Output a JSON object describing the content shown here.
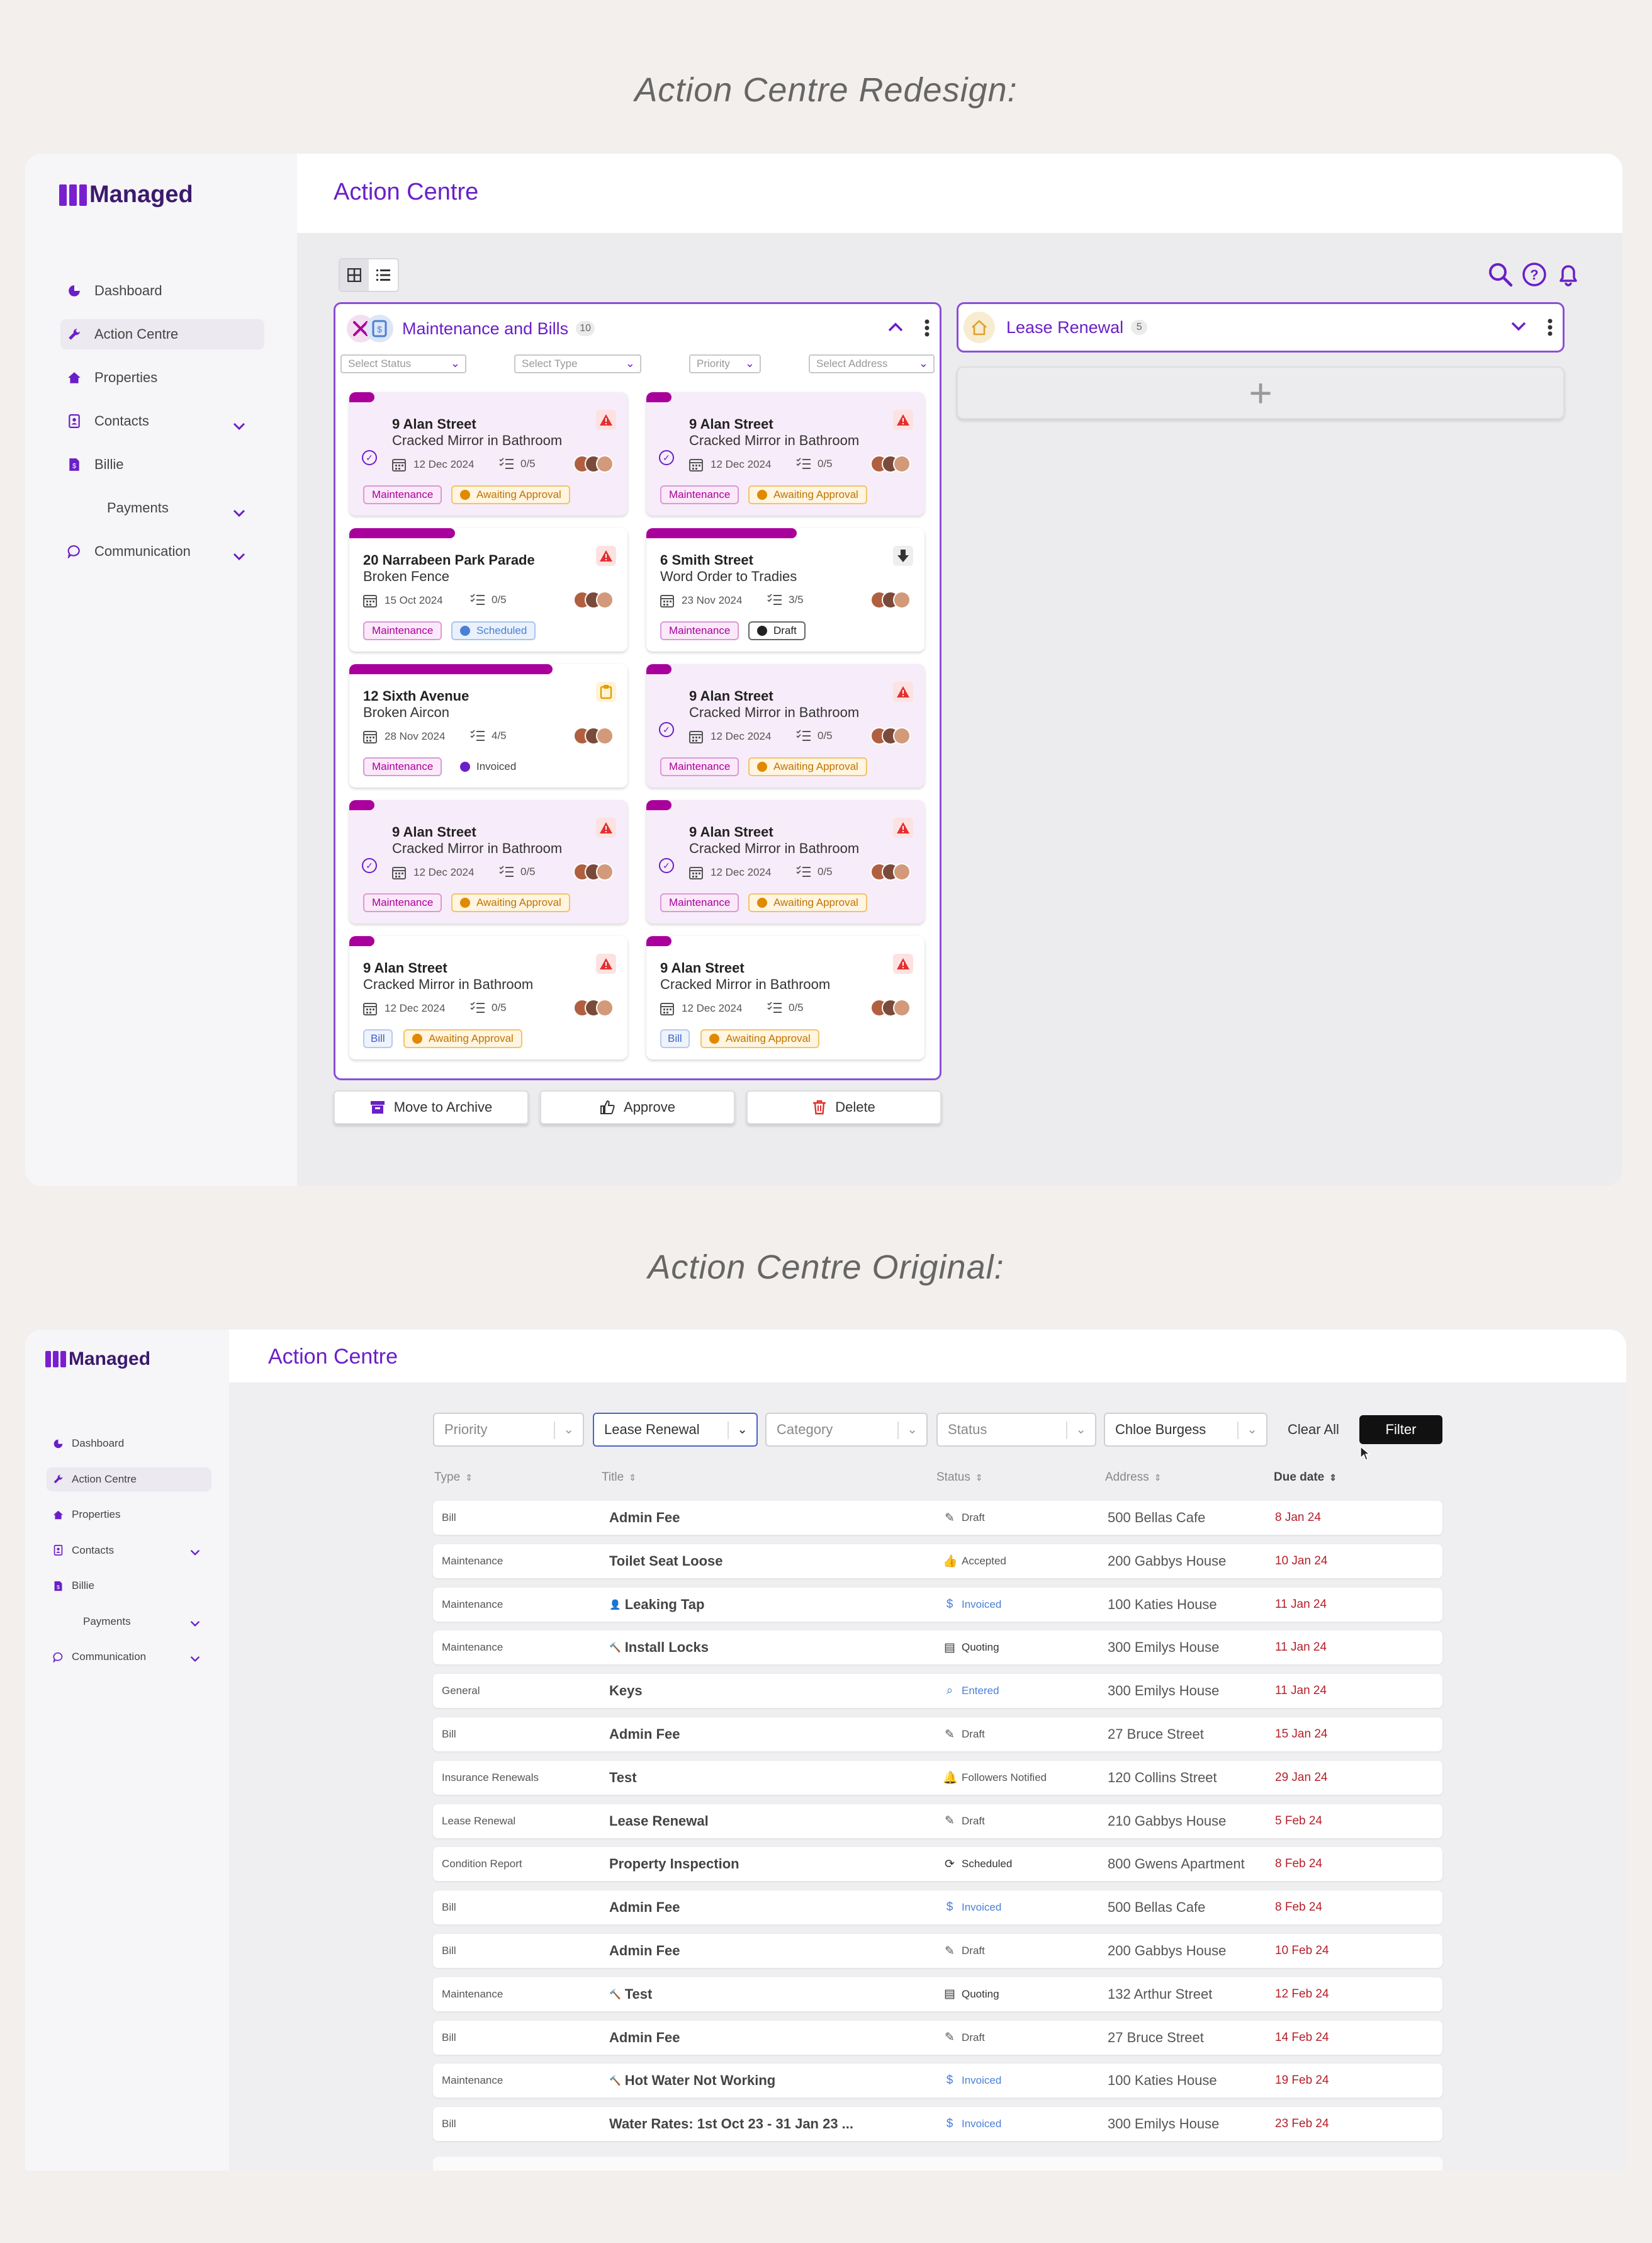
{
  "headings": {
    "redesign": "Action Centre Redesign:",
    "original": "Action Centre Original:"
  },
  "brand": {
    "name": "Managed",
    "accent": "#6a1fc7",
    "magenta": "#a9009c"
  },
  "nav": [
    {
      "label": "Dashboard",
      "icon": "pie-chart-icon",
      "chevron": false,
      "active": false
    },
    {
      "label": "Action Centre",
      "icon": "wrench-icon",
      "chevron": false,
      "active": true
    },
    {
      "label": "Properties",
      "icon": "home-icon",
      "chevron": false,
      "active": false
    },
    {
      "label": "Contacts",
      "icon": "contact-book-icon",
      "chevron": true,
      "active": false
    },
    {
      "label": "Billie",
      "icon": "bill-icon",
      "chevron": false,
      "active": false
    },
    {
      "label": "Payments",
      "icon": "",
      "chevron": true,
      "active": false
    },
    {
      "label": "Communication",
      "icon": "chat-bubble-icon",
      "chevron": true,
      "active": false
    }
  ],
  "redesign": {
    "title": "Action Centre",
    "groups": {
      "maintenance": {
        "title": "Maintenance and Bills",
        "count": "10"
      },
      "lease": {
        "title": "Lease Renewal",
        "count": "5"
      }
    },
    "filters": {
      "status": "Select Status",
      "type": "Select Type",
      "priority": "Priority",
      "address": "Select Address"
    },
    "cards": [
      {
        "address": "9 Alan Street",
        "description": "Cracked Mirror in Bathroom",
        "date": "12 Dec 2024",
        "tasks": "0/5",
        "category": "Maintenance",
        "status": "Awaiting Approval",
        "status_color": "#e08a00",
        "progress": 0.07,
        "bg": "pink",
        "checked": true,
        "flag": "warning"
      },
      {
        "address": "9 Alan Street",
        "description": "Cracked Mirror in Bathroom",
        "date": "12 Dec 2024",
        "tasks": "0/5",
        "category": "Maintenance",
        "status": "Awaiting Approval",
        "status_color": "#e08a00",
        "progress": 0.07,
        "bg": "pink",
        "checked": true,
        "flag": "warning"
      },
      {
        "address": "20 Narrabeen Park Parade",
        "description": "Broken Fence",
        "date": "15 Oct 2024",
        "tasks": "0/5",
        "category": "Maintenance",
        "status": "Scheduled",
        "status_color": "#4a7fd6",
        "progress": 0.38,
        "bg": "white",
        "checked": false,
        "flag": "warning"
      },
      {
        "address": "6 Smith Street",
        "description": "Word Order to Tradies",
        "date": "23 Nov 2024",
        "tasks": "3/5",
        "category": "Maintenance",
        "status": "Draft",
        "status_color": "#222222",
        "progress": 0.54,
        "bg": "white",
        "checked": false,
        "flag": "download"
      },
      {
        "address": "12 Sixth Avenue",
        "description": "Broken Aircon",
        "date": "28 Nov 2024",
        "tasks": "4/5",
        "category": "Maintenance",
        "status": "Invoiced",
        "status_color": "#6a1fc7",
        "progress": 0.73,
        "bg": "white",
        "checked": false,
        "flag": "clipboard"
      },
      {
        "address": "9 Alan Street",
        "description": "Cracked Mirror in Bathroom",
        "date": "12 Dec 2024",
        "tasks": "0/5",
        "category": "Maintenance",
        "status": "Awaiting Approval",
        "status_color": "#e08a00",
        "progress": 0.07,
        "bg": "pink",
        "checked": true,
        "flag": "warning"
      },
      {
        "address": "9 Alan Street",
        "description": "Cracked Mirror in Bathroom",
        "date": "12 Dec 2024",
        "tasks": "0/5",
        "category": "Maintenance",
        "status": "Awaiting Approval",
        "status_color": "#e08a00",
        "progress": 0.07,
        "bg": "pink",
        "checked": true,
        "flag": "warning"
      },
      {
        "address": "9 Alan Street",
        "description": "Cracked Mirror in Bathroom",
        "date": "12 Dec 2024",
        "tasks": "0/5",
        "category": "Maintenance",
        "status": "Awaiting Approval",
        "status_color": "#e08a00",
        "progress": 0.07,
        "bg": "pink",
        "checked": true,
        "flag": "warning"
      },
      {
        "address": "9 Alan Street",
        "description": "Cracked Mirror in Bathroom",
        "date": "12 Dec 2024",
        "tasks": "0/5",
        "category": "Bill",
        "status": "Awaiting Approval",
        "status_color": "#e08a00",
        "progress": 0.07,
        "bg": "white",
        "checked": false,
        "flag": "warning"
      },
      {
        "address": "9 Alan Street",
        "description": "Cracked Mirror in Bathroom",
        "date": "12 Dec 2024",
        "tasks": "0/5",
        "category": "Bill",
        "status": "Awaiting Approval",
        "status_color": "#e08a00",
        "progress": 0.07,
        "bg": "white",
        "checked": false,
        "flag": "warning"
      }
    ],
    "actions": {
      "archive": "Move to Archive",
      "approve": "Approve",
      "delete": "Delete"
    }
  },
  "original": {
    "title": "Action Centre",
    "filters": {
      "priority": "Priority",
      "category_selected": "Lease Renewal",
      "category": "Category",
      "status": "Status",
      "person": "Chloe Burgess",
      "clear": "Clear All",
      "filter": "Filter"
    },
    "columns": {
      "type": "Type",
      "title": "Title",
      "status": "Status",
      "address": "Address",
      "due": "Due date"
    },
    "rows": [
      {
        "type": "Bill",
        "title": "Admin Fee",
        "status": "Draft",
        "status_icon": "edit-icon",
        "status_color": "#555555",
        "address": "500 Bellas Cafe",
        "due": "8 Jan 24"
      },
      {
        "type": "Maintenance",
        "title": "Toilet Seat Loose",
        "status": "Accepted",
        "status_icon": "thumbs-up-icon",
        "status_color": "#555555",
        "address": "200 Gabbys House",
        "due": "10 Jan 24"
      },
      {
        "type": "Maintenance",
        "title": "Leaking Tap",
        "status": "Invoiced",
        "status_icon": "dollar-icon",
        "status_color": "#4a7fd6",
        "address": "100 Katies House",
        "due": "11 Jan 24",
        "title_icon": "person-icon"
      },
      {
        "type": "Maintenance",
        "title": "Install Locks",
        "status": "Quoting",
        "status_icon": "document-icon",
        "status_color": "#333333",
        "address": "300 Emilys House",
        "due": "11 Jan 24",
        "title_icon": "hammer-icon"
      },
      {
        "type": "General",
        "title": "Keys",
        "status": "Entered",
        "status_icon": "search-icon",
        "status_color": "#4a7fd6",
        "address": "300 Emilys House",
        "due": "11 Jan 24"
      },
      {
        "type": "Bill",
        "title": "Admin Fee",
        "status": "Draft",
        "status_icon": "edit-icon",
        "status_color": "#555555",
        "address": "27 Bruce Street",
        "due": "15 Jan 24"
      },
      {
        "type": "Insurance Renewals",
        "title": "Test",
        "status": "Followers Notified",
        "status_icon": "bell-icon",
        "status_color": "#555555",
        "address": "120 Collins Street",
        "due": "29 Jan 24"
      },
      {
        "type": "Lease Renewal",
        "title": "Lease Renewal",
        "status": "Draft",
        "status_icon": "edit-icon",
        "status_color": "#555555",
        "address": "210 Gabbys House",
        "due": "5 Feb 24"
      },
      {
        "type": "Condition Report",
        "title": "Property Inspection",
        "status": "Scheduled",
        "status_icon": "refresh-icon",
        "status_color": "#333333",
        "address": "800 Gwens Apartment",
        "due": "8 Feb 24"
      },
      {
        "type": "Bill",
        "title": "Admin Fee",
        "status": "Invoiced",
        "status_icon": "dollar-icon",
        "status_color": "#4a7fd6",
        "address": "500 Bellas Cafe",
        "due": "8 Feb 24"
      },
      {
        "type": "Bill",
        "title": "Admin Fee",
        "status": "Draft",
        "status_icon": "edit-icon",
        "status_color": "#555555",
        "address": "200 Gabbys House",
        "due": "10 Feb 24"
      },
      {
        "type": "Maintenance",
        "title": "Test",
        "status": "Quoting",
        "status_icon": "document-icon",
        "status_color": "#333333",
        "address": "132 Arthur Street",
        "due": "12 Feb 24",
        "title_icon": "hammer-icon"
      },
      {
        "type": "Bill",
        "title": "Admin Fee",
        "status": "Draft",
        "status_icon": "edit-icon",
        "status_color": "#555555",
        "address": "27 Bruce Street",
        "due": "14 Feb 24"
      },
      {
        "type": "Maintenance",
        "title": "Hot Water Not Working",
        "status": "Invoiced",
        "status_icon": "dollar-icon",
        "status_color": "#4a7fd6",
        "address": "100 Katies House",
        "due": "19 Feb 24",
        "title_icon": "hammer-icon"
      },
      {
        "type": "Bill",
        "title": "Water Rates: 1st Oct 23 - 31 Jan 23 ...",
        "status": "Invoiced",
        "status_icon": "dollar-icon",
        "status_color": "#4a7fd6",
        "address": "300 Emilys House",
        "due": "23 Feb 24"
      }
    ]
  }
}
